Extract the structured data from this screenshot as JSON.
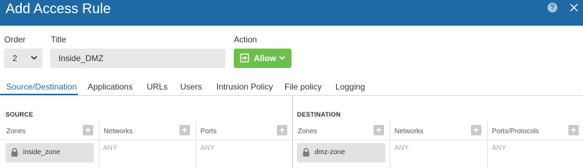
{
  "dialog": {
    "title": "Add Access Rule",
    "help_icon": "help-icon",
    "close_icon": "close-icon",
    "header_color": "#1f6aa5"
  },
  "form": {
    "order": {
      "label": "Order",
      "value": "2"
    },
    "title": {
      "label": "Title",
      "value": "Inside_DMZ"
    },
    "action": {
      "label": "Action",
      "value": "Allow",
      "color": "#6cc04a"
    }
  },
  "tabs": [
    {
      "label": "Source/Destination",
      "active": true
    },
    {
      "label": "Applications"
    },
    {
      "label": "URLs"
    },
    {
      "label": "Users"
    },
    {
      "label": "Intrusion Policy"
    },
    {
      "label": "File policy"
    },
    {
      "label": "Logging"
    }
  ],
  "source": {
    "title": "SOURCE",
    "columns": [
      {
        "label": "Zones",
        "items": [
          "inside_zone"
        ]
      },
      {
        "label": "Networks",
        "empty": "ANY"
      },
      {
        "label": "Ports",
        "empty": "ANY"
      }
    ]
  },
  "destination": {
    "title": "DESTINATION",
    "columns": [
      {
        "label": "Zones",
        "items": [
          "dmz-zone"
        ]
      },
      {
        "label": "Networks",
        "empty": "ANY"
      },
      {
        "label": "Ports/Protocols",
        "empty": "ANY"
      }
    ]
  }
}
